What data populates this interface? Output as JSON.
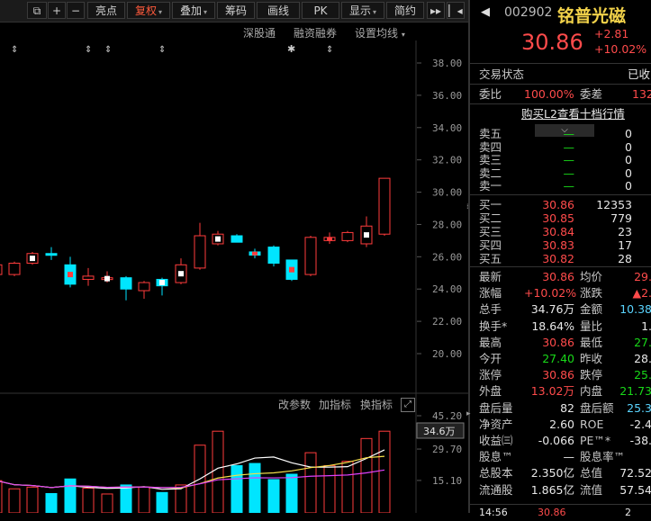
{
  "toolbar": {
    "items": [
      "亮点",
      "复权",
      "叠加",
      "筹码",
      "画线",
      "PK",
      "显示",
      "简约"
    ],
    "active": "复权"
  },
  "chart": {
    "top_controls": [
      "深股通",
      "融资融券",
      "设置均线"
    ],
    "indicator_controls": [
      "改参数",
      "加指标",
      "换指标"
    ],
    "price_axis": [
      "38.00",
      "36.00",
      "34.00",
      "32.00",
      "30.00",
      "28.00",
      "26.00",
      "24.00",
      "22.00",
      "20.00"
    ],
    "volume_axis": [
      "45.20",
      "29.70",
      "15.10"
    ],
    "volume_tag": "34.6万",
    "colors": {
      "up": "#ff3c3c",
      "down": "#00e5ff",
      "ma1": "#ffffff",
      "ma2": "#f5e04a",
      "ma3": "#e040fb"
    },
    "candles": [
      {
        "o": 24.9,
        "c": 25.5,
        "h": 25.7,
        "l": 24.7
      },
      {
        "o": 24.9,
        "c": 25.6,
        "h": 25.7,
        "l": 24.8
      },
      {
        "o": 25.6,
        "c": 26.2,
        "h": 26.3,
        "l": 25.5
      },
      {
        "o": 26.2,
        "c": 26.1,
        "h": 26.6,
        "l": 25.8
      },
      {
        "o": 25.5,
        "c": 24.3,
        "h": 26.0,
        "l": 24.1
      },
      {
        "o": 24.6,
        "c": 24.8,
        "h": 25.3,
        "l": 24.2
      },
      {
        "o": 24.6,
        "c": 24.7,
        "h": 25.1,
        "l": 24.4
      },
      {
        "o": 24.7,
        "c": 24.0,
        "h": 24.8,
        "l": 23.3
      },
      {
        "o": 23.9,
        "c": 24.4,
        "h": 24.5,
        "l": 23.4
      },
      {
        "o": 24.6,
        "c": 24.2,
        "h": 24.7,
        "l": 23.6
      },
      {
        "o": 24.4,
        "c": 25.5,
        "h": 25.9,
        "l": 24.3
      },
      {
        "o": 25.3,
        "c": 27.3,
        "h": 28.1,
        "l": 25.2
      },
      {
        "o": 26.8,
        "c": 27.4,
        "h": 27.6,
        "l": 26.7
      },
      {
        "o": 27.3,
        "c": 26.9,
        "h": 27.4,
        "l": 26.9
      },
      {
        "o": 26.3,
        "c": 26.1,
        "h": 26.5,
        "l": 25.9
      },
      {
        "o": 26.6,
        "c": 25.6,
        "h": 26.7,
        "l": 25.4
      },
      {
        "o": 25.8,
        "c": 24.6,
        "h": 25.8,
        "l": 24.5
      },
      {
        "o": 24.9,
        "c": 27.2,
        "h": 27.3,
        "l": 24.8
      },
      {
        "o": 27.0,
        "c": 27.2,
        "h": 27.5,
        "l": 26.8
      },
      {
        "o": 27.0,
        "c": 27.5,
        "h": 27.6,
        "l": 26.9
      },
      {
        "o": 26.8,
        "c": 27.9,
        "h": 28.5,
        "l": 26.6
      },
      {
        "o": 27.4,
        "c": 30.86,
        "h": 30.86,
        "l": 27.3
      }
    ],
    "volumes": [
      15.0,
      11.2,
      12.0,
      9.0,
      15.8,
      11.5,
      8.8,
      13.0,
      12.0,
      9.5,
      13.0,
      31.5,
      38.0,
      22.0,
      23.0,
      15.5,
      18.0,
      28.0,
      22.0,
      24.0,
      34.6,
      38.0
    ]
  },
  "quote": {
    "code": "002902",
    "name": "铭普光磁",
    "price": "30.86",
    "change": "+2.81",
    "change_pct": "+10.02%",
    "status_label": "交易状态",
    "status_value": "已收",
    "weibi_label": "委比",
    "weibi_value": "100.00%",
    "weicha_label": "委差",
    "weicha_value": "132",
    "l2_link": "购买L2查看十档行情",
    "asks": [
      {
        "label": "卖五",
        "price": "—",
        "vol": "0"
      },
      {
        "label": "卖四",
        "price": "—",
        "vol": "0"
      },
      {
        "label": "卖三",
        "price": "—",
        "vol": "0"
      },
      {
        "label": "卖二",
        "price": "—",
        "vol": "0"
      },
      {
        "label": "卖一",
        "price": "—",
        "vol": "0"
      }
    ],
    "bids": [
      {
        "label": "买一",
        "price": "30.86",
        "vol": "12353"
      },
      {
        "label": "买二",
        "price": "30.85",
        "vol": "779"
      },
      {
        "label": "买三",
        "price": "30.84",
        "vol": "23"
      },
      {
        "label": "买四",
        "price": "30.83",
        "vol": "17"
      },
      {
        "label": "买五",
        "price": "30.82",
        "vol": "28"
      }
    ],
    "stats": [
      {
        "l1": "最新",
        "v1": "30.86",
        "c1": "red",
        "l2": "均价",
        "v2": "29.",
        "c2": "red"
      },
      {
        "l1": "涨幅",
        "v1": "+10.02%",
        "c1": "red",
        "l2": "涨跌",
        "v2": "▲2.",
        "c2": "red"
      },
      {
        "l1": "总手",
        "v1": "34.76万",
        "c1": "white",
        "l2": "金额",
        "v2": "10.38",
        "c2": "cyan"
      },
      {
        "l1": "换手*",
        "v1": "18.64%",
        "c1": "white",
        "l2": "量比",
        "v2": "1.",
        "c2": "white"
      },
      {
        "l1": "最高",
        "v1": "30.86",
        "c1": "red",
        "l2": "最低",
        "v2": "27.",
        "c2": "green"
      },
      {
        "l1": "今开",
        "v1": "27.40",
        "c1": "green",
        "l2": "昨收",
        "v2": "28.",
        "c2": "white"
      },
      {
        "l1": "涨停",
        "v1": "30.86",
        "c1": "red",
        "l2": "跌停",
        "v2": "25.",
        "c2": "green"
      },
      {
        "l1": "外盘",
        "v1": "13.02万",
        "c1": "red",
        "l2": "内盘",
        "v2": "21.73",
        "c2": "green"
      },
      {
        "l1": "盘后量",
        "v1": "82",
        "c1": "white",
        "l2": "盘后额",
        "v2": "25.3",
        "c2": "cyan"
      },
      {
        "l1": "净资产",
        "v1": "2.60",
        "c1": "white",
        "l2": "ROE",
        "v2": "-2.4",
        "c2": "white"
      },
      {
        "l1": "收益㈢",
        "v1": "-0.066",
        "c1": "white",
        "l2": "PE™*",
        "v2": "-38.",
        "c2": "white"
      },
      {
        "l1": "股息™",
        "v1": "—",
        "c1": "white",
        "l2": "股息率™",
        "v2": "",
        "c2": "white"
      },
      {
        "l1": "总股本",
        "v1": "2.350亿",
        "c1": "white",
        "l2": "总值",
        "v2": "72.52",
        "c2": "white"
      },
      {
        "l1": "流通股",
        "v1": "1.865亿",
        "c1": "white",
        "l2": "流值",
        "v2": "57.54",
        "c2": "white"
      }
    ],
    "bottom_time": "14:56",
    "bottom_price": "30.86",
    "bottom_vol": "2"
  }
}
